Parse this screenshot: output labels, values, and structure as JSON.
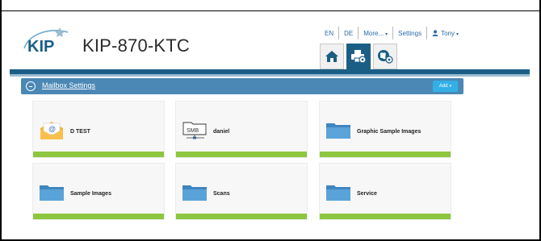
{
  "app": {
    "logo_text": "KIP",
    "title": "KIP-870-KTC"
  },
  "topnav": {
    "lang_en": "EN",
    "lang_de": "DE",
    "more": "More...",
    "settings": "Settings",
    "user": "Tony"
  },
  "tabs": [
    {
      "icon": "home-icon"
    },
    {
      "icon": "print-settings-icon",
      "active": true
    },
    {
      "icon": "globe-settings-icon"
    }
  ],
  "panel": {
    "title": "Mailbox Settings",
    "add": "Add"
  },
  "mailboxes": [
    {
      "name": "D TEST",
      "icon": "email-icon"
    },
    {
      "name": "daniel",
      "icon": "smb-share-icon"
    },
    {
      "name": "Graphic Sample Images",
      "icon": "folder-icon"
    },
    {
      "name": "Sample Images",
      "icon": "folder-icon"
    },
    {
      "name": "Scans",
      "icon": "folder-icon"
    },
    {
      "name": "Service",
      "icon": "folder-icon"
    }
  ],
  "colors": {
    "brand_blue": "#1b5e85",
    "panel_blue": "#4b88b5",
    "add_button": "#34b0e6",
    "card_bar_green": "#8dc63f",
    "link_blue": "#2a6aa8"
  }
}
